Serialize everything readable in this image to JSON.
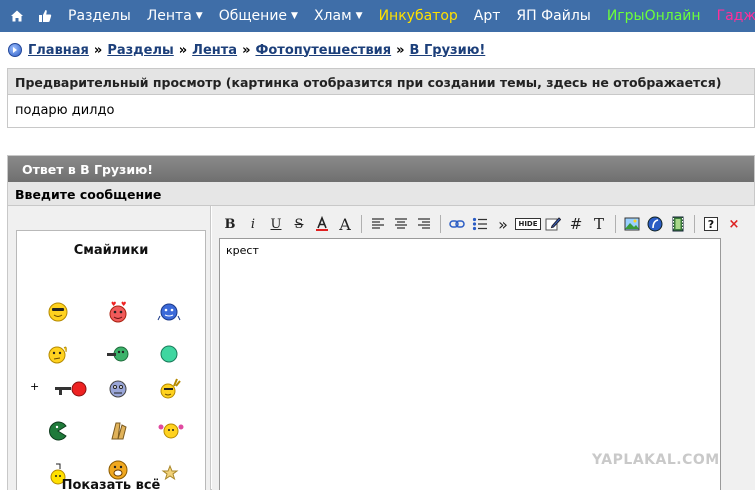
{
  "nav": {
    "items": [
      {
        "label": "Разделы",
        "color": "#ffffff",
        "dropdown": false
      },
      {
        "label": "Лента",
        "color": "#ffffff",
        "dropdown": true
      },
      {
        "label": "Общение",
        "color": "#ffffff",
        "dropdown": true
      },
      {
        "label": "Хлам",
        "color": "#ffffff",
        "dropdown": true
      },
      {
        "label": "Инкубатор",
        "color": "#ffe100",
        "dropdown": false
      },
      {
        "label": "Арт",
        "color": "#ffffff",
        "dropdown": false
      },
      {
        "label": "ЯП Файлы",
        "color": "#ffffff",
        "dropdown": false
      },
      {
        "label": "ИгрыОнлайн",
        "color": "#6cff3a",
        "dropdown": false
      },
      {
        "label": "Гадж",
        "color": "#ff2f9a",
        "dropdown": false
      }
    ]
  },
  "breadcrumb": {
    "items": [
      "Главная",
      "Разделы",
      "Лента",
      "Фотопутешествия",
      "В Грузию!"
    ],
    "separator": "»"
  },
  "preview": {
    "title": "Предварительный просмотр (картинка отобразится при создании темы, здесь не отображается)",
    "text": "подарю дилдо"
  },
  "reply": {
    "title": "Ответ в В Грузию!",
    "subtitle": "Введите сообщение"
  },
  "smilies": {
    "title": "Смайлики",
    "show_all": "Показать всё",
    "extra_mark": "+"
  },
  "toolbar": {
    "bold": "B",
    "italic": "i",
    "underline": "U",
    "strike": "S",
    "font_size": "A",
    "quote": "»",
    "hide": "HIDE",
    "hash": "#",
    "typo": "T",
    "close": "×"
  },
  "editor": {
    "value": "крест"
  },
  "watermark": "YAPLAKAL.COM",
  "colors": {
    "nav_bg": "#3f6ea8",
    "link": "#1c3f7a",
    "reply_header": "#7a7a7a"
  }
}
